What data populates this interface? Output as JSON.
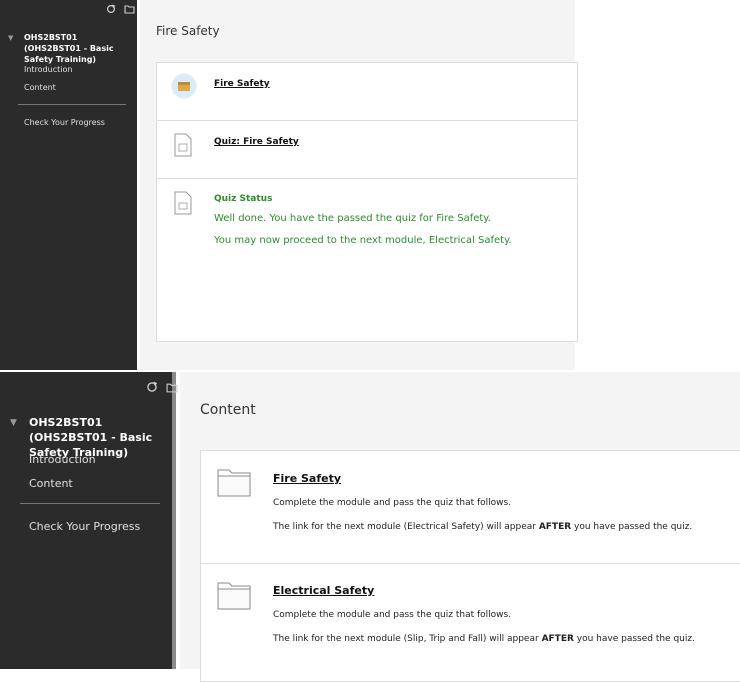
{
  "top": {
    "sidebar": {
      "course_title": "OHS2BST01 (OHS2BST01 - Basic Safety Training)",
      "items": [
        {
          "label": "Introduction"
        },
        {
          "label": "Content"
        },
        {
          "label": "Check Your Progress"
        }
      ]
    },
    "page_title": "Fire Safety",
    "content_items": [
      {
        "title": "Fire Safety"
      },
      {
        "title": "Quiz: Fire Safety"
      },
      {
        "title": "Quiz Status",
        "lines": [
          "Well done. You have the passed the quiz for Fire Safety.",
          "You may now proceed to the next module, Electrical Safety."
        ]
      }
    ]
  },
  "bottom": {
    "sidebar": {
      "course_title": "OHS2BST01 (OHS2BST01 - Basic Safety Training)",
      "items": [
        {
          "label": "Introduction"
        },
        {
          "label": "Content"
        },
        {
          "label": "Check Your Progress"
        }
      ]
    },
    "page_title": "Content",
    "content_items": [
      {
        "title": "Fire Safety",
        "line1": "Complete the module and pass the quiz that follows.",
        "line2_pre": "The link for the next module (Electrical Safety) will appear ",
        "line2_bold": "AFTER",
        "line2_post": " you have passed the quiz."
      },
      {
        "title": "Electrical Safety",
        "line1": "Complete the module and pass the quiz that follows.",
        "line2_pre": "The link for the next module (Slip, Trip and Fall) will appear ",
        "line2_bold": "AFTER",
        "line2_post": " you have passed the quiz."
      }
    ]
  },
  "colors": {
    "sidebar_bg": "#2b2b2b",
    "status_green": "#2e8b2e",
    "page_bg": "#f4f4f4"
  },
  "icons": [
    "refresh-icon",
    "folder-icon",
    "collapse-caret-icon",
    "module-thumbnail-icon",
    "quiz-document-icon",
    "folder-item-icon"
  ]
}
